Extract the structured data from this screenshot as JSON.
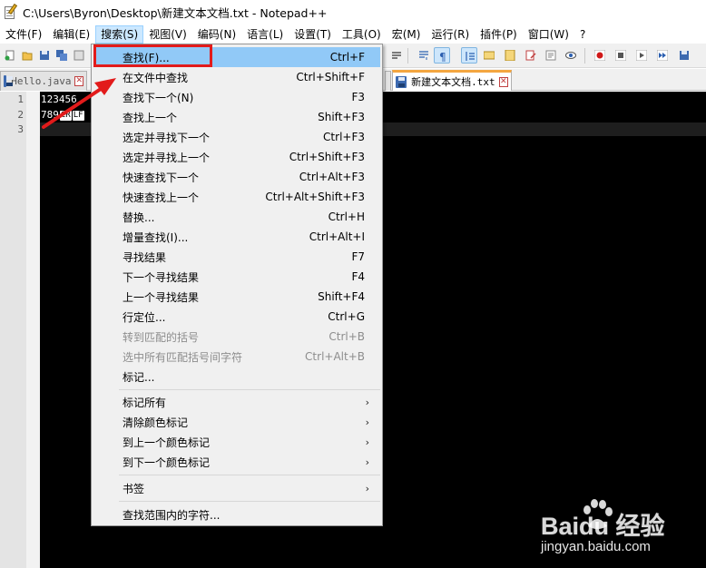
{
  "window": {
    "title": "C:\\Users\\Byron\\Desktop\\新建文本文档.txt - Notepad++"
  },
  "menubar": [
    {
      "label": "文件(F)"
    },
    {
      "label": "编辑(E)"
    },
    {
      "label": "搜索(S)",
      "active": true
    },
    {
      "label": "视图(V)"
    },
    {
      "label": "编码(N)"
    },
    {
      "label": "语言(L)"
    },
    {
      "label": "设置(T)"
    },
    {
      "label": "工具(O)"
    },
    {
      "label": "宏(M)"
    },
    {
      "label": "运行(R)"
    },
    {
      "label": "插件(P)"
    },
    {
      "label": "窗口(W)"
    },
    {
      "label": "?"
    }
  ],
  "tabs": [
    {
      "label": "Hello.java",
      "active": false
    },
    {
      "label": "新建文本文档.txt",
      "active": true
    }
  ],
  "editor": {
    "line_numbers": [
      "1",
      "2",
      "3"
    ],
    "lines": [
      "123456",
      "789",
      ""
    ],
    "eol_markers": [
      "CR",
      "LF"
    ],
    "background": "#000000"
  },
  "search_menu": {
    "items": [
      {
        "label": "查找(F)...",
        "shortcut": "Ctrl+F",
        "highlighted": true
      },
      {
        "label": "在文件中查找",
        "shortcut": "Ctrl+Shift+F"
      },
      {
        "label": "查找下一个(N)",
        "shortcut": "F3"
      },
      {
        "label": "查找上一个",
        "shortcut": "Shift+F3"
      },
      {
        "label": "选定并寻找下一个",
        "shortcut": "Ctrl+F3"
      },
      {
        "label": "选定并寻找上一个",
        "shortcut": "Ctrl+Shift+F3"
      },
      {
        "label": "快速查找下一个",
        "shortcut": "Ctrl+Alt+F3"
      },
      {
        "label": "快速查找上一个",
        "shortcut": "Ctrl+Alt+Shift+F3"
      },
      {
        "label": "替换...",
        "shortcut": "Ctrl+H"
      },
      {
        "label": "增量查找(I)...",
        "shortcut": "Ctrl+Alt+I"
      },
      {
        "label": "寻找结果",
        "shortcut": "F7"
      },
      {
        "label": "下一个寻找结果",
        "shortcut": "F4"
      },
      {
        "label": "上一个寻找结果",
        "shortcut": "Shift+F4"
      },
      {
        "label": "行定位...",
        "shortcut": "Ctrl+G"
      },
      {
        "label": "转到匹配的括号",
        "shortcut": "Ctrl+B",
        "disabled": true
      },
      {
        "label": "选中所有匹配括号间字符",
        "shortcut": "Ctrl+Alt+B",
        "disabled": true
      },
      {
        "label": "标记...",
        "shortcut": ""
      },
      {
        "label": "标记所有",
        "submenu": true
      },
      {
        "label": "清除颜色标记",
        "submenu": true
      },
      {
        "label": "到上一个颜色标记",
        "submenu": true
      },
      {
        "label": "到下一个颜色标记",
        "submenu": true
      },
      {
        "label": "书签",
        "submenu": true
      },
      {
        "label": "查找范围内的字符..."
      }
    ]
  },
  "watermark": {
    "brand": "Baidu 经验",
    "url": "jingyan.baidu.com"
  },
  "colors": {
    "menu_highlight": "#91c9f7",
    "annotation_red": "#e21b1b",
    "active_tab_accent": "#f4a640"
  }
}
